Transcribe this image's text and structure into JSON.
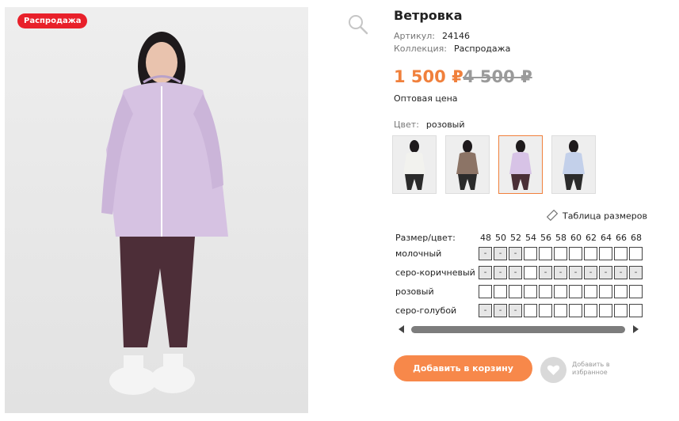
{
  "product": {
    "badge": "Распродажа",
    "title": "Ветровка",
    "article_label": "Артикул:",
    "article_value": "24146",
    "collection_label": "Коллекция:",
    "collection_value": "Распродажа",
    "price": "1 500 ₽",
    "old_price": "4 500 ₽",
    "wholesale": "Оптовая цена",
    "color_label": "Цвет:",
    "color_value": "розовый"
  },
  "thumbnails": [
    {
      "name": "молочный",
      "coat": "#f2f2ee",
      "pants": "#2b2b2b"
    },
    {
      "name": "серо-коричневый",
      "coat": "#8c7466",
      "pants": "#2b2b2b"
    },
    {
      "name": "розовый",
      "coat": "#d7c3e6",
      "pants": "#4a2f36"
    },
    {
      "name": "серо-голубой",
      "coat": "#c3d0ea",
      "pants": "#2b2b2b"
    }
  ],
  "size_table_link": "Таблица размеров",
  "grid": {
    "header": "Размер/цвет:",
    "sizes": [
      "48",
      "50",
      "52",
      "54",
      "56",
      "58",
      "60",
      "62",
      "64",
      "66",
      "68"
    ],
    "rows": [
      {
        "label": "молочный",
        "cells": [
          "-",
          "-",
          "-",
          "",
          "",
          "",
          "",
          "",
          "",
          "",
          ""
        ]
      },
      {
        "label": "серо-коричневый",
        "cells": [
          "-",
          "-",
          "-",
          "",
          "-",
          "-",
          "-",
          "-",
          "-",
          "-",
          "-"
        ]
      },
      {
        "label": "розовый",
        "cells": [
          "",
          "",
          "",
          "",
          "",
          "",
          "",
          "",
          "",
          "",
          ""
        ]
      },
      {
        "label": "серо-голубой",
        "cells": [
          "-",
          "-",
          "-",
          "",
          "",
          "",
          "",
          "",
          "",
          "",
          ""
        ]
      }
    ]
  },
  "actions": {
    "add_to_cart": "Добавить в корзину",
    "favorite_line1": "Добавить в",
    "favorite_line2": "избранное"
  },
  "colors": {
    "accent": "#f0803c",
    "badge": "#e8202a",
    "button": "#f7884a"
  },
  "icons": {
    "zoom": "search-icon",
    "ruler": "ruler-icon",
    "heart": "heart-icon"
  }
}
